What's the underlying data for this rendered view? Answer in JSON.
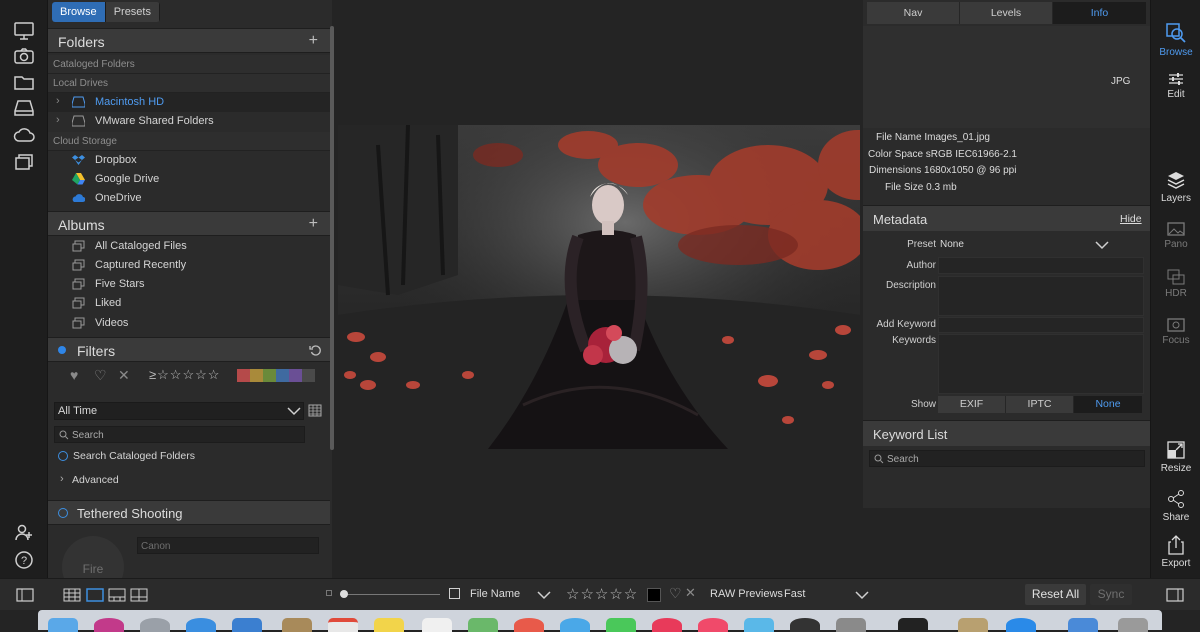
{
  "left_panel": {
    "tabs": [
      {
        "label": "Browse",
        "active": true
      },
      {
        "label": "Presets",
        "active": false
      }
    ],
    "folders_title": "Folders",
    "cataloged_folders": "Cataloged Folders",
    "local_drives": "Local Drives",
    "local_items": [
      "Macintosh HD",
      "VMware Shared Folders"
    ],
    "cloud_storage": "Cloud Storage",
    "cloud_items": [
      "Dropbox",
      "Google Drive",
      "OneDrive"
    ],
    "albums_title": "Albums",
    "album_items": [
      "All Cataloged Files",
      "Captured Recently",
      "Five Stars",
      "Liked",
      "Videos"
    ],
    "filters_title": "Filters",
    "rating_filter": "≥☆☆☆☆☆",
    "label_colors": [
      "#b54a4a",
      "#a98a3a",
      "#6a8a3a",
      "#3f6aa0",
      "#6a4f95",
      "#4a4a4a"
    ],
    "time_filter": "All Time",
    "search_placeholder": "Search",
    "search_cataloged": "Search Cataloged Folders",
    "advanced": "Advanced",
    "tethered_title": "Tethered Shooting",
    "camera_placeholder": "Canon",
    "fire_label": "Fire"
  },
  "right_panel": {
    "tabs": [
      {
        "label": "Nav",
        "active": false
      },
      {
        "label": "Levels",
        "active": false
      },
      {
        "label": "Info",
        "active": true
      }
    ],
    "file_type": "JPG",
    "info": {
      "file_name": "File Name Images_01.jpg",
      "color_space": "Color Space sRGB IEC61966-2.1",
      "dimensions": "Dimensions 1680x1050 @ 96 ppi",
      "file_size": "File Size 0.3 mb"
    },
    "metadata_title": "Metadata",
    "hide_label": "Hide",
    "preset_label": "Preset",
    "preset_value": "None",
    "author_label": "Author",
    "description_label": "Description",
    "add_keyword_label": "Add Keyword",
    "keywords_label": "Keywords",
    "show_label": "Show",
    "show_tabs": [
      {
        "label": "EXIF",
        "active": false
      },
      {
        "label": "IPTC",
        "active": false
      },
      {
        "label": "None",
        "active": true
      }
    ],
    "keyword_list_title": "Keyword List",
    "keyword_search_placeholder": "Search"
  },
  "right_rail": {
    "items": [
      {
        "label": "Browse",
        "icon": "browse-icon",
        "state": "active"
      },
      {
        "label": "Edit",
        "icon": "sliders-icon",
        "state": "normal"
      },
      {
        "label": "Layers",
        "icon": "layers-icon",
        "state": "normal"
      },
      {
        "label": "Pano",
        "icon": "pano-icon",
        "state": "dim"
      },
      {
        "label": "HDR",
        "icon": "hdr-icon",
        "state": "dim"
      },
      {
        "label": "Focus",
        "icon": "focus-icon",
        "state": "dim"
      },
      {
        "label": "Resize",
        "icon": "resize-icon",
        "state": "normal"
      },
      {
        "label": "Share",
        "icon": "share-icon",
        "state": "normal"
      },
      {
        "label": "Export",
        "icon": "export-icon",
        "state": "normal"
      }
    ]
  },
  "bottom_bar": {
    "sort_label": "File Name",
    "stars": "☆☆☆☆☆",
    "raw_previews_label": "RAW Previews",
    "raw_previews_value": "Fast",
    "reset_all": "Reset All",
    "sync": "Sync"
  },
  "colors": {
    "accent": "#2f6db5",
    "accent_text": "#4f9bf0"
  }
}
